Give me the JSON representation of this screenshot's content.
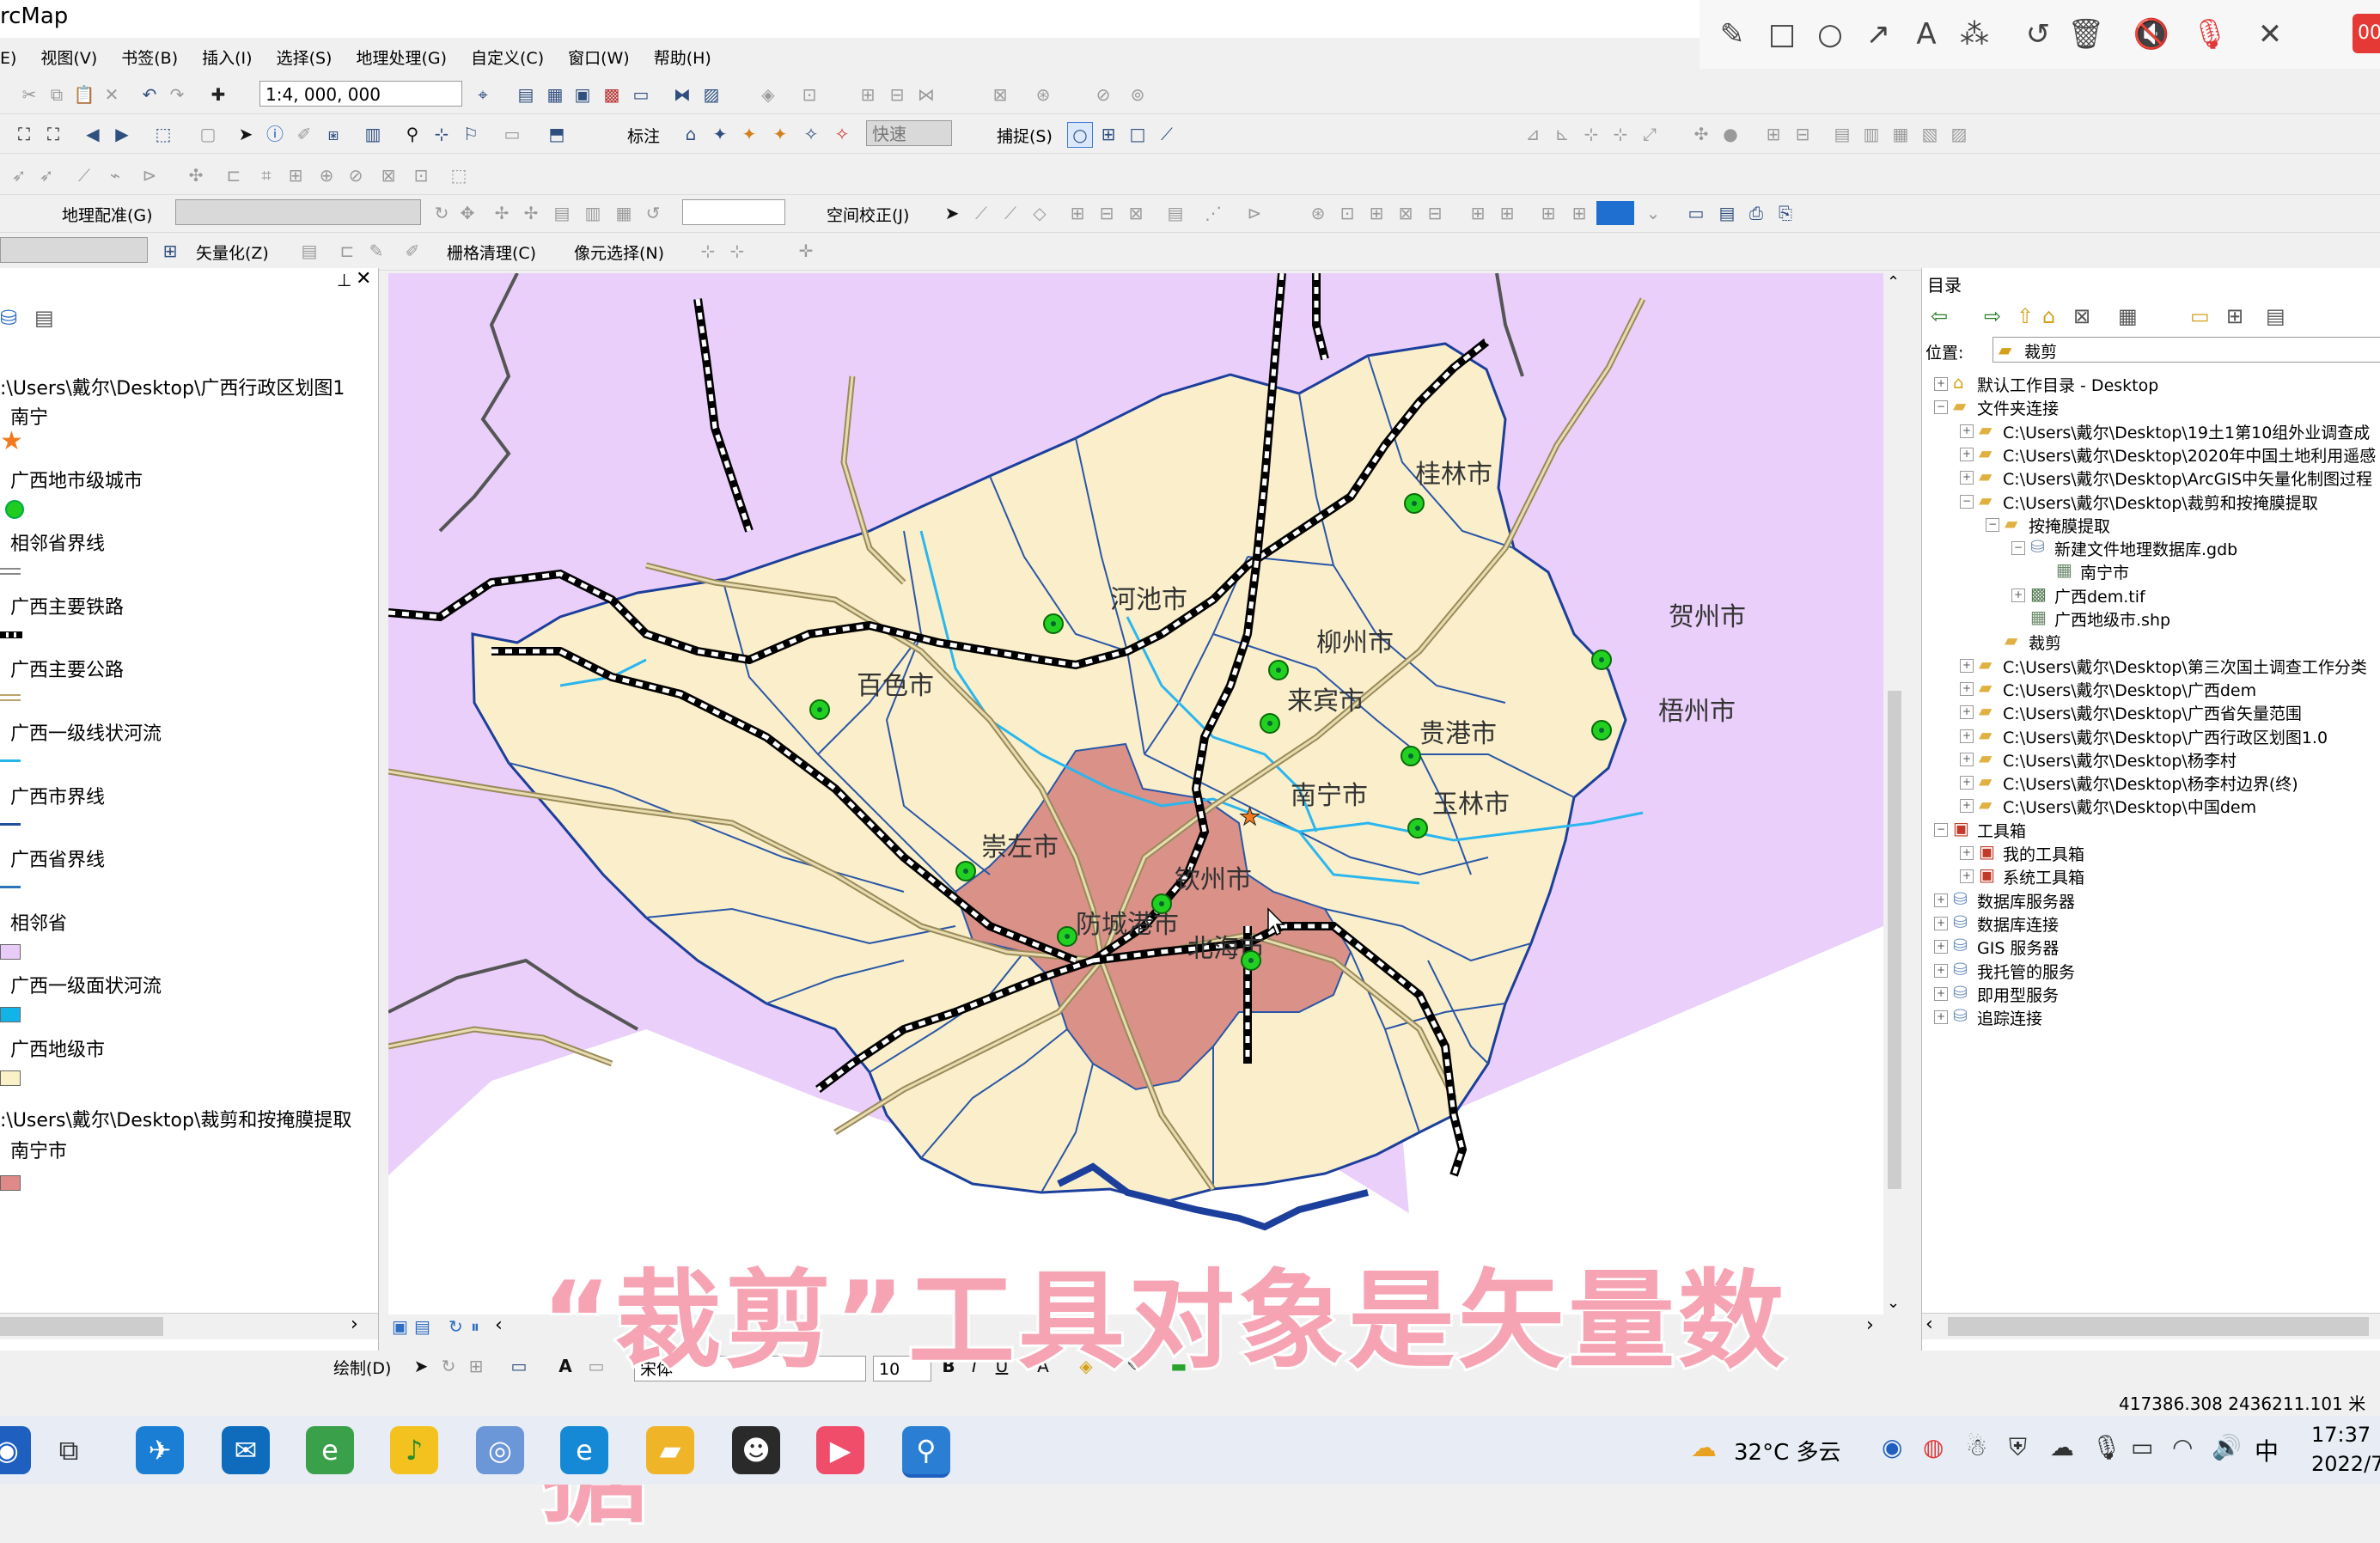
{
  "app": {
    "title": "rcMap"
  },
  "menu": [
    "E)",
    "视图(V)",
    "书签(B)",
    "插入(I)",
    "选择(S)",
    "地理处理(G)",
    "自定义(C)",
    "窗口(W)",
    "帮助(H)"
  ],
  "toolbar": {
    "scale": "1:4, 000, 000",
    "label_tool": "标注",
    "speed": "快速",
    "snap": "捕捉(S)",
    "georef": "地理配准(G)",
    "spatial_adjust": "空间校正(J)",
    "vectorize": "矢量化(Z)",
    "raster_cleanup": "栅格清理(C)",
    "pixel_select": "像元选择(N)",
    "draw": "绘制(D)",
    "font": "宋体",
    "font_size": "10"
  },
  "toc": {
    "path1": ":\\Users\\戴尔\\Desktop\\广西行政区划图1",
    "path2": ":\\Users\\戴尔\\Desktop\\裁剪和按掩膜提取",
    "layers": [
      {
        "name": "南宁",
        "sym": "star",
        "color": "#f47a1f"
      },
      {
        "name": "广西地市级城市",
        "sym": "dot",
        "color": "#1fcc1f"
      },
      {
        "name": "相邻省界线",
        "sym": "double",
        "color": "#888888"
      },
      {
        "name": "广西主要铁路",
        "sym": "rail",
        "color": "#000000"
      },
      {
        "name": "广西主要公路",
        "sym": "road",
        "color": "#b8a36a"
      },
      {
        "name": "广西一级线状河流",
        "sym": "line",
        "color": "#22b7e8"
      },
      {
        "name": "广西市界线",
        "sym": "line",
        "color": "#1f4f9a"
      },
      {
        "name": "广西省界线",
        "sym": "line",
        "color": "#2b74b8"
      },
      {
        "name": "相邻省",
        "sym": "box",
        "color": "#e8ccf7"
      },
      {
        "name": "广西一级面状河流",
        "sym": "box",
        "color": "#12b3e8"
      },
      {
        "name": "广西地级市",
        "sym": "box",
        "color": "#fbf1c8"
      }
    ],
    "clip_layer": {
      "name": "南宁市",
      "color": "#de8a88"
    }
  },
  "map": {
    "colors": {
      "neighbor": "#e9cffa",
      "guangxi": "#faefca",
      "nanning": "#d99188",
      "county": "#2a56a8",
      "river": "#2ab6ee",
      "coast": "#1c3f9c",
      "border": "#555555"
    },
    "cities": [
      "桂林市",
      "河池市",
      "贺州市",
      "柳州市",
      "百色市",
      "来宾市",
      "梧州市",
      "贵港市",
      "南宁市",
      "玉林市",
      "崇左市",
      "钦州市",
      "防城港市",
      "北海市"
    ]
  },
  "catalog": {
    "title": "目录",
    "location_label": "位置:",
    "location_value": "裁剪",
    "items": [
      {
        "label": "默认工作目录 - Desktop",
        "level": 0,
        "exp": "+",
        "icon": "home"
      },
      {
        "label": "文件夹连接",
        "level": 0,
        "exp": "-",
        "icon": "folder"
      },
      {
        "label": "C:\\Users\\戴尔\\Desktop\\19土1第10组外业调查成",
        "level": 1,
        "exp": "+",
        "icon": "folder"
      },
      {
        "label": "C:\\Users\\戴尔\\Desktop\\2020年中国土地利用遥感",
        "level": 1,
        "exp": "+",
        "icon": "folder"
      },
      {
        "label": "C:\\Users\\戴尔\\Desktop\\ArcGIS中矢量化制图过程",
        "level": 1,
        "exp": "+",
        "icon": "folder"
      },
      {
        "label": "C:\\Users\\戴尔\\Desktop\\裁剪和按掩膜提取",
        "level": 1,
        "exp": "-",
        "icon": "folder"
      },
      {
        "label": "按掩膜提取",
        "level": 2,
        "exp": "-",
        "icon": "folder"
      },
      {
        "label": "新建文件地理数据库.gdb",
        "level": 3,
        "exp": "-",
        "icon": "gdb"
      },
      {
        "label": "南宁市",
        "level": 4,
        "exp": "",
        "icon": "fc"
      },
      {
        "label": "广西dem.tif",
        "level": 3,
        "exp": "+",
        "icon": "raster"
      },
      {
        "label": "广西地级市.shp",
        "level": 3,
        "exp": "",
        "icon": "fc"
      },
      {
        "label": "裁剪",
        "level": 2,
        "exp": "",
        "icon": "folder"
      },
      {
        "label": "C:\\Users\\戴尔\\Desktop\\第三次国土调查工作分类",
        "level": 1,
        "exp": "+",
        "icon": "folder"
      },
      {
        "label": "C:\\Users\\戴尔\\Desktop\\广西dem",
        "level": 1,
        "exp": "+",
        "icon": "folder"
      },
      {
        "label": "C:\\Users\\戴尔\\Desktop\\广西省矢量范围",
        "level": 1,
        "exp": "+",
        "icon": "folder"
      },
      {
        "label": "C:\\Users\\戴尔\\Desktop\\广西行政区划图1.0",
        "level": 1,
        "exp": "+",
        "icon": "folder"
      },
      {
        "label": "C:\\Users\\戴尔\\Desktop\\杨李村",
        "level": 1,
        "exp": "+",
        "icon": "folder"
      },
      {
        "label": "C:\\Users\\戴尔\\Desktop\\杨李村边界(终)",
        "level": 1,
        "exp": "+",
        "icon": "folder"
      },
      {
        "label": "C:\\Users\\戴尔\\Desktop\\中国dem",
        "level": 1,
        "exp": "+",
        "icon": "folder"
      },
      {
        "label": "工具箱",
        "level": 0,
        "exp": "-",
        "icon": "toolbox"
      },
      {
        "label": "我的工具箱",
        "level": 1,
        "exp": "+",
        "icon": "toolbox"
      },
      {
        "label": "系统工具箱",
        "level": 1,
        "exp": "+",
        "icon": "toolbox"
      },
      {
        "label": "数据库服务器",
        "level": 0,
        "exp": "+",
        "icon": "db"
      },
      {
        "label": "数据库连接",
        "level": 0,
        "exp": "+",
        "icon": "db"
      },
      {
        "label": "GIS 服务器",
        "level": 0,
        "exp": "+",
        "icon": "db"
      },
      {
        "label": "我托管的服务",
        "level": 0,
        "exp": "+",
        "icon": "db"
      },
      {
        "label": "即用型服务",
        "level": 0,
        "exp": "+",
        "icon": "db"
      },
      {
        "label": "追踪连接",
        "level": 0,
        "exp": "+",
        "icon": "db"
      }
    ]
  },
  "status": {
    "coords": "417386.308  2436211.101 米"
  },
  "subtitle": "“裁剪”工具对象是矢量数据",
  "taskbar": {
    "weather": "32°C 多云",
    "ime": "中",
    "time": "17:37",
    "date": "2022/7/"
  },
  "record": {
    "label": "00"
  }
}
